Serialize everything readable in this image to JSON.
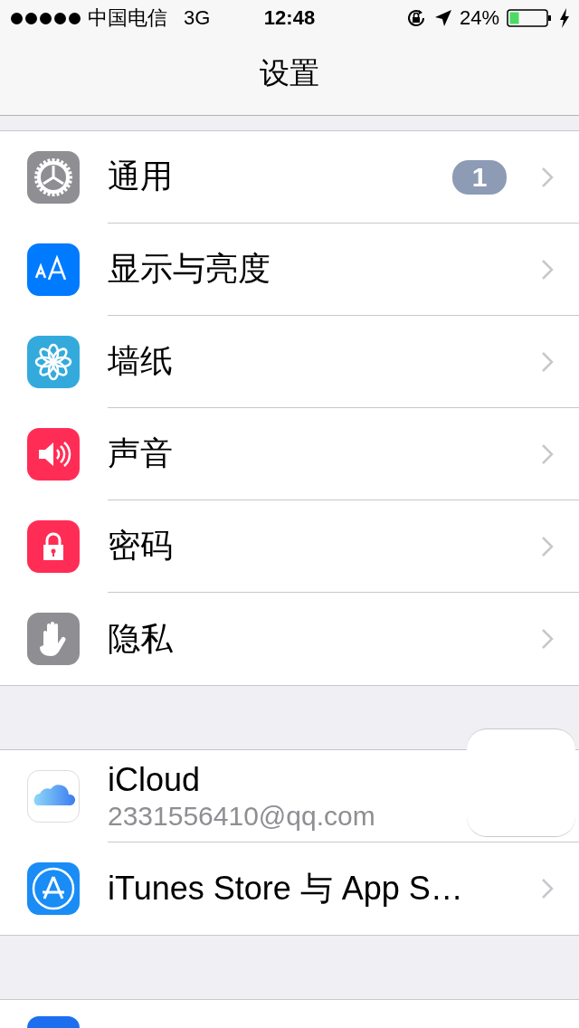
{
  "status_bar": {
    "carrier": "中国电信",
    "network": "3G",
    "time": "12:48",
    "battery": "24%"
  },
  "nav": {
    "title": "设置"
  },
  "sections": [
    {
      "rows": [
        {
          "kind": "full",
          "label": "通用",
          "badge": "1"
        },
        {
          "kind": "full",
          "label": "显示与亮度"
        },
        {
          "kind": "full",
          "label": "墙纸"
        },
        {
          "kind": "full",
          "label": "声音"
        },
        {
          "kind": "full",
          "label": "密码"
        },
        {
          "kind": "full",
          "label": "隐私"
        }
      ]
    },
    {
      "rows": [
        {
          "kind": "full",
          "label": "iCloud",
          "detail": "2331556410@qq.com"
        },
        {
          "kind": "full",
          "label": "iTunes Store 与 App S…"
        }
      ]
    },
    {
      "rows": [
        {
          "kind": "cut_off"
        }
      ]
    }
  ]
}
